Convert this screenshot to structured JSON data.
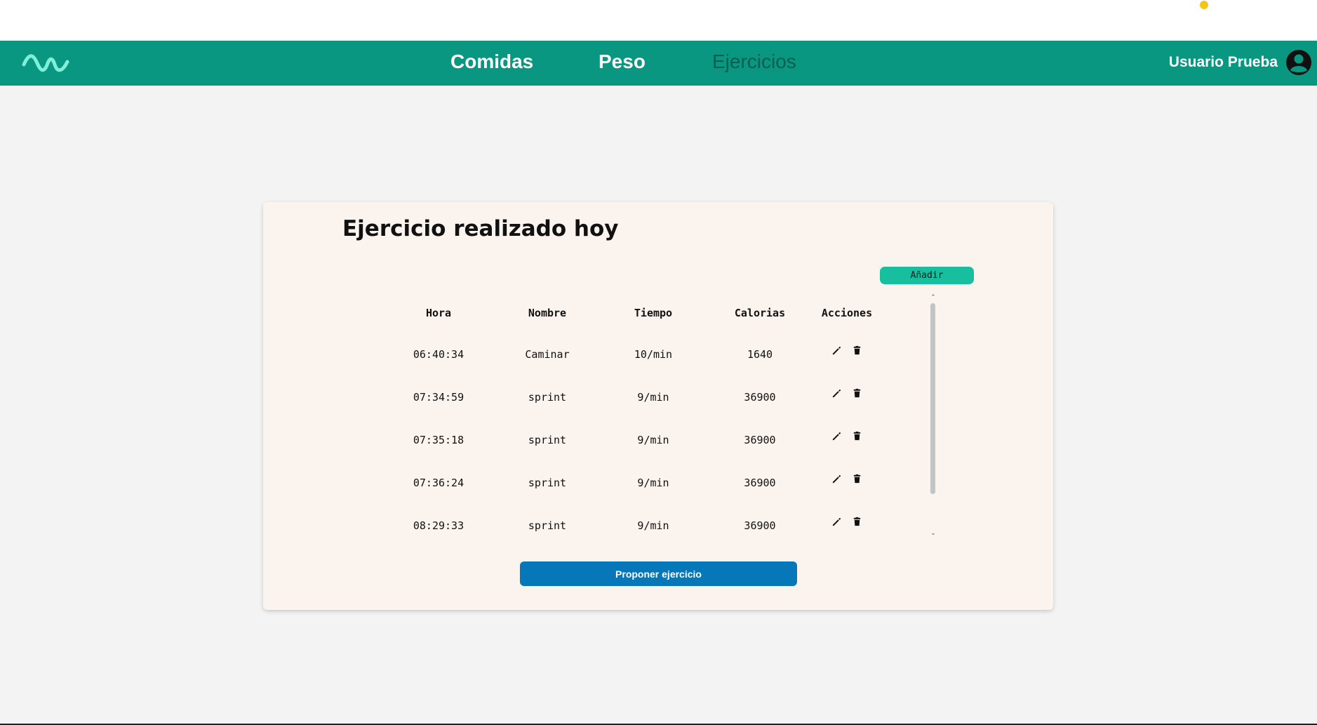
{
  "nav": {
    "logo_icon": "wave-logo-icon",
    "links": [
      {
        "label": "Comidas",
        "active": false
      },
      {
        "label": "Peso",
        "active": false
      },
      {
        "label": "Ejercicios",
        "active": true
      }
    ],
    "user_name": "Usuario Prueba",
    "avatar_icon": "user-circle-icon"
  },
  "main": {
    "title": "Ejercicio realizado hoy",
    "add_label": "Añadir",
    "table": {
      "headers": [
        "Hora",
        "Nombre",
        "Tiempo",
        "Calorias",
        "Acciones"
      ],
      "rows": [
        {
          "hora": "06:40:34",
          "nombre": "Caminar",
          "tiempo": "10/min",
          "calorias": "1640"
        },
        {
          "hora": "07:34:59",
          "nombre": "sprint",
          "tiempo": "9/min",
          "calorias": "36900"
        },
        {
          "hora": "07:35:18",
          "nombre": "sprint",
          "tiempo": "9/min",
          "calorias": "36900"
        },
        {
          "hora": "07:36:24",
          "nombre": "sprint",
          "tiempo": "9/min",
          "calorias": "36900"
        },
        {
          "hora": "08:29:33",
          "nombre": "sprint",
          "tiempo": "9/min",
          "calorias": "36900"
        }
      ],
      "row_action_icons": [
        "pencil-icon",
        "trash-icon"
      ]
    },
    "propose_label": "Proponer ejercicio"
  },
  "colors": {
    "navbar": "#0a9782",
    "active_link": "#0b5e51",
    "card_bg": "#fbf3ee",
    "add_button": "#17bf9f",
    "propose_button": "#0677b8",
    "page_bg": "#f3f3f3"
  }
}
